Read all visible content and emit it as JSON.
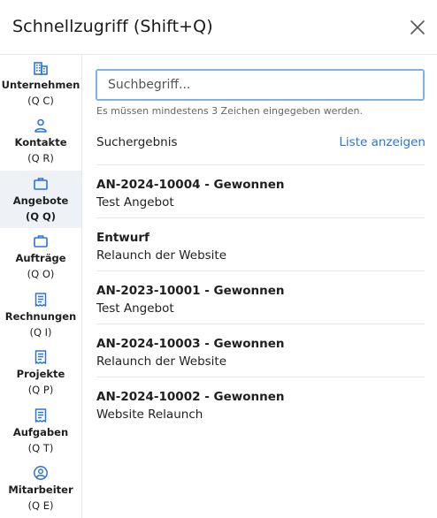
{
  "dialog": {
    "title": "Schnellzugriff (Shift+Q)"
  },
  "sidebar": {
    "items": [
      {
        "label": "Unternehmen",
        "shortcut": "(Q C)",
        "icon": "building-icon"
      },
      {
        "label": "Kontakte",
        "shortcut": "(Q R)",
        "icon": "user-icon"
      },
      {
        "label": "Angebote",
        "shortcut": "(Q Q)",
        "icon": "briefcase-icon",
        "active": true
      },
      {
        "label": "Aufträge",
        "shortcut": "(Q O)",
        "icon": "briefcase-icon"
      },
      {
        "label": "Rechnungen",
        "shortcut": "(Q I)",
        "icon": "receipt-icon"
      },
      {
        "label": "Projekte",
        "shortcut": "(Q P)",
        "icon": "receipt-icon"
      },
      {
        "label": "Aufgaben",
        "shortcut": "(Q T)",
        "icon": "receipt-icon"
      },
      {
        "label": "Mitarbeiter",
        "shortcut": "(Q E)",
        "icon": "user-circle-icon"
      }
    ]
  },
  "search": {
    "placeholder": "Suchbegriff...",
    "value": "",
    "hint": "Es müssen mindestens 3 Zeichen eingegeben werden."
  },
  "results": {
    "heading": "Suchergebnis",
    "list_link": "Liste anzeigen",
    "items": [
      {
        "title": "AN-2024-10004 - Gewonnen",
        "subtitle": "Test Angebot"
      },
      {
        "title": "Entwurf",
        "subtitle": "Relaunch der Website"
      },
      {
        "title": "AN-2023-10001 - Gewonnen",
        "subtitle": "Test Angebot"
      },
      {
        "title": "AN-2024-10003 - Gewonnen",
        "subtitle": "Relaunch der Website"
      },
      {
        "title": "AN-2024-10002 - Gewonnen",
        "subtitle": "Website Relaunch"
      }
    ]
  },
  "colors": {
    "accent": "#2b74d9",
    "active_bg": "#eef1f6",
    "search_border": "#7fb0e6"
  }
}
